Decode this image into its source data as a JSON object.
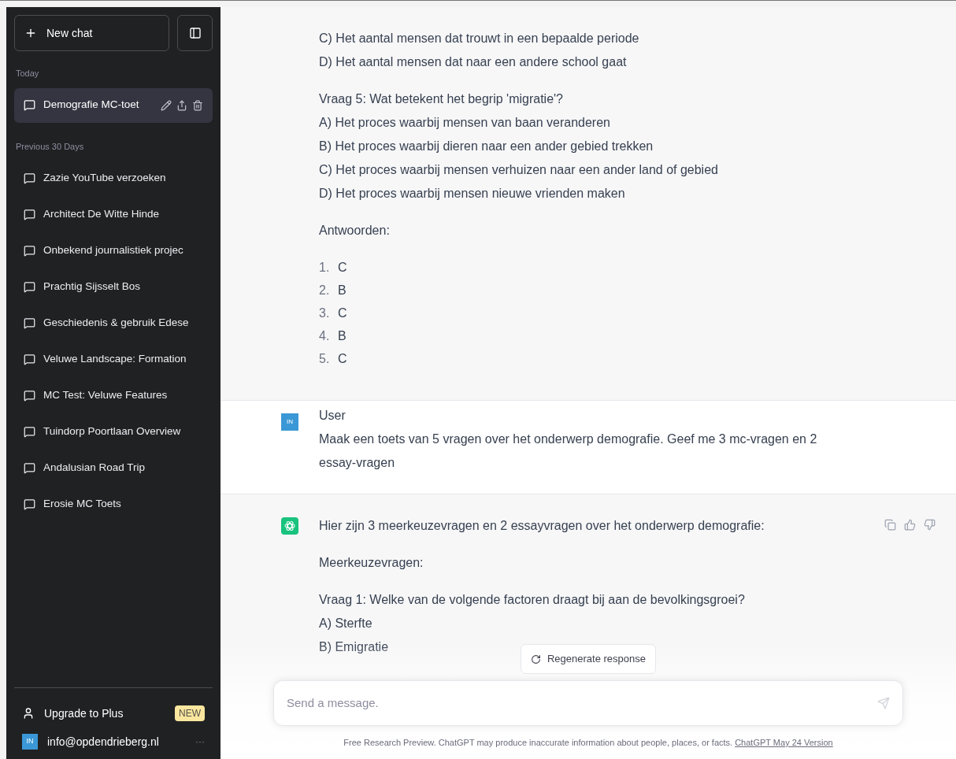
{
  "sidebar": {
    "new_chat": "New chat",
    "sections": [
      {
        "heading": "Today",
        "items": [
          {
            "label": "Demografie MC-toet",
            "selected": true
          }
        ]
      },
      {
        "heading": "Previous 30 Days",
        "items": [
          {
            "label": "Zazie YouTube verzoeken",
            "selected": false
          },
          {
            "label": "Architect De Witte Hinde",
            "selected": false
          },
          {
            "label": "Onbekend journalistiek projec",
            "selected": false
          },
          {
            "label": "Prachtig Sijsselt Bos",
            "selected": false
          },
          {
            "label": "Geschiedenis & gebruik Edese",
            "selected": false
          },
          {
            "label": "Veluwe Landscape: Formation",
            "selected": false
          },
          {
            "label": "MC Test: Veluwe Features",
            "selected": false
          },
          {
            "label": "Tuindorp Poortlaan Overview",
            "selected": false
          },
          {
            "label": "Andalusian Road Trip",
            "selected": false
          },
          {
            "label": "Erosie MC Toets",
            "selected": false
          }
        ]
      }
    ],
    "upgrade": {
      "label": "Upgrade to Plus",
      "badge": "NEW"
    },
    "account": {
      "avatar": "IN",
      "email": "info@opdendrieberg.nl",
      "more": "···"
    }
  },
  "messages": [
    {
      "kind": "assistant",
      "actions_visible": false,
      "blocks": [
        {
          "kind": "lines",
          "lines": [
            "C) Het aantal mensen dat trouwt in een bepaalde periode",
            "D) Het aantal mensen dat naar een andere school gaat"
          ]
        },
        {
          "kind": "lines",
          "lines": [
            "Vraag 5: Wat betekent het begrip 'migratie'?",
            "A) Het proces waarbij mensen van baan veranderen",
            "B) Het proces waarbij dieren naar een ander gebied trekken",
            "C) Het proces waarbij mensen verhuizen naar een ander land of gebied",
            "D) Het proces waarbij mensen nieuwe vrienden maken"
          ]
        },
        {
          "kind": "lines",
          "lines": [
            "Antwoorden:"
          ]
        },
        {
          "kind": "list",
          "items": [
            {
              "number": "1.",
              "text": "C"
            },
            {
              "number": "2.",
              "text": "B"
            },
            {
              "number": "3.",
              "text": "C"
            },
            {
              "number": "4.",
              "text": "B"
            },
            {
              "number": "5.",
              "text": "C"
            }
          ]
        }
      ]
    },
    {
      "kind": "user",
      "avatar": "IN",
      "author": "User",
      "blocks": [
        {
          "kind": "lines",
          "lines": [
            "Maak een toets van 5 vragen over het onderwerp demografie. Geef me 3 mc-vragen en 2 essay-vragen"
          ]
        }
      ]
    },
    {
      "kind": "assistant",
      "actions_visible": true,
      "blocks": [
        {
          "kind": "lines",
          "lines": [
            "Hier zijn 3 meerkeuzevragen en 2 essayvragen over het onderwerp demografie:"
          ]
        },
        {
          "kind": "lines",
          "lines": [
            "Meerkeuzevragen:"
          ]
        },
        {
          "kind": "lines",
          "lines": [
            "Vraag 1: Welke van de volgende factoren draagt bij aan de bevolkingsgroei?",
            "A) Sterfte",
            "B) Emigratie"
          ]
        }
      ]
    }
  ],
  "regenerate": "Regenerate response",
  "composer": {
    "placeholder": "Send a message."
  },
  "footer": {
    "text": "Free Research Preview. ChatGPT may produce inaccurate information about people, places, or facts.",
    "link": "ChatGPT May 24 Version"
  }
}
